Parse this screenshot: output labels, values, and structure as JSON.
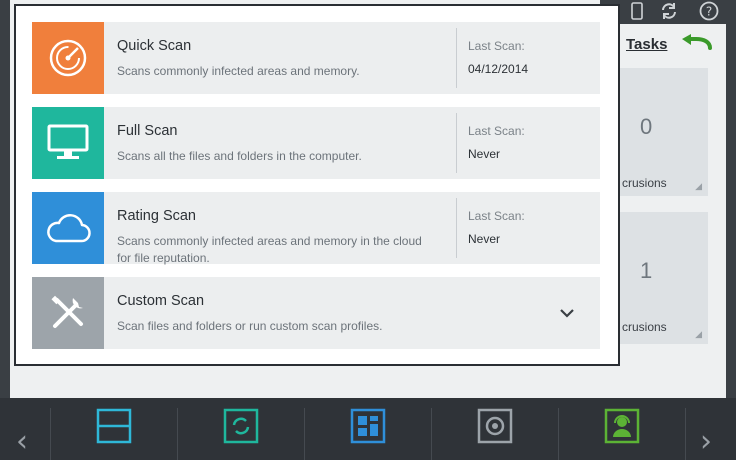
{
  "header": {
    "icons": [
      "phone-icon",
      "refresh-icon",
      "help-icon"
    ]
  },
  "tasks": {
    "label": "Tasks"
  },
  "stats": [
    {
      "value": "0",
      "label": "crusions"
    },
    {
      "value": "1",
      "label": "crusions"
    }
  ],
  "scan_menu": {
    "items": [
      {
        "title": "Quick Scan",
        "description": "Scans commonly infected areas and memory.",
        "last_scan_label": "Last Scan:",
        "last_scan_value": "04/12/2014",
        "color": "#f07f3c",
        "icon": "gauge-icon"
      },
      {
        "title": "Full Scan",
        "description": "Scans all the files and folders in the computer.",
        "last_scan_label": "Last Scan:",
        "last_scan_value": "Never",
        "color": "#1fb79d",
        "icon": "monitor-icon"
      },
      {
        "title": "Rating Scan",
        "description": "Scans commonly infected areas and memory in the cloud for file reputation.",
        "last_scan_label": "Last Scan:",
        "last_scan_value": "Never",
        "color": "#2f8fd9",
        "icon": "cloud-icon"
      },
      {
        "title": "Custom Scan",
        "description": "Scan files and folders or run custom scan profiles.",
        "color": "#9da4aa",
        "icon": "tools-icon"
      }
    ]
  },
  "bottom_nav": {
    "prev_arrow": "‹",
    "next_arrow": "›",
    "items": [
      {
        "icon": "scan-icon",
        "color": "#2fb8d8"
      },
      {
        "icon": "update-icon",
        "color": "#1fb79d"
      },
      {
        "icon": "dashboard-icon",
        "color": "#2f8fd9"
      },
      {
        "icon": "vault-icon",
        "color": "#9da4aa"
      },
      {
        "icon": "support-icon",
        "color": "#5cb335"
      }
    ]
  }
}
